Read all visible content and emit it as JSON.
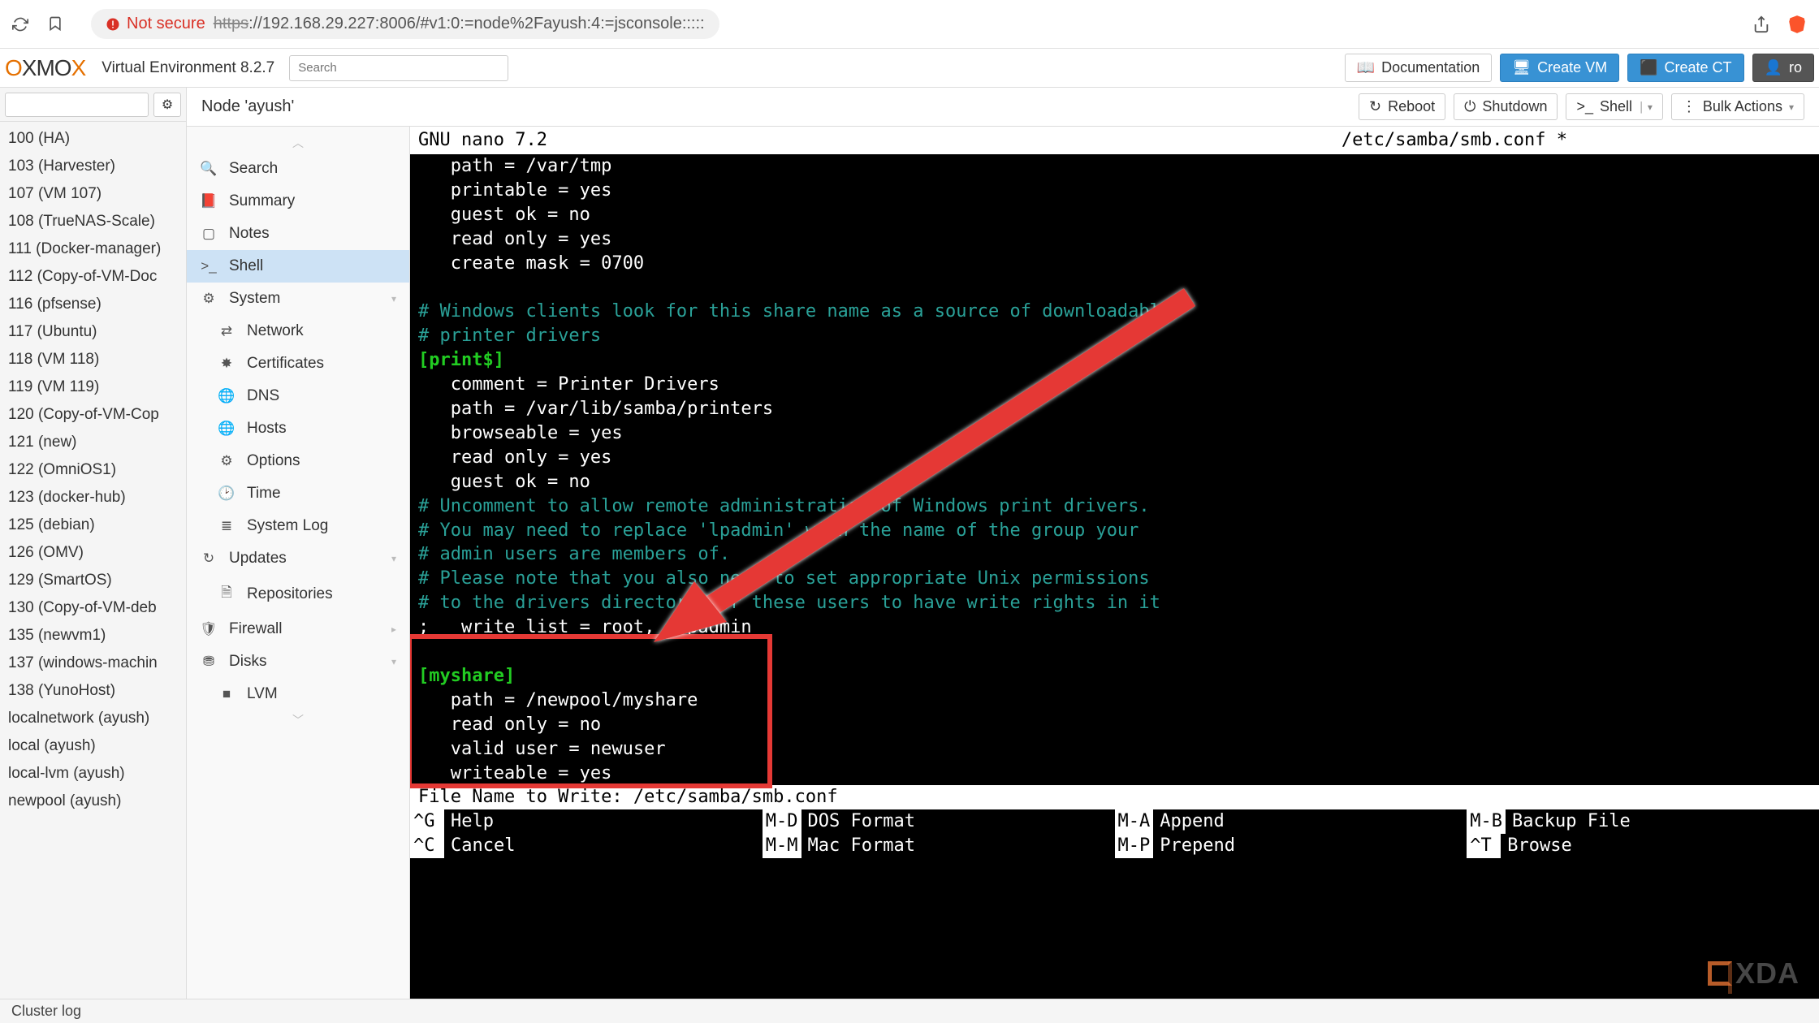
{
  "browser": {
    "not_secure": "Not secure",
    "url_scheme": "https",
    "url_rest": "://192.168.29.227:8006/#v1:0:=node%2Fayush:4:=jsconsole:::::"
  },
  "header": {
    "logo_pre": "O",
    "logo_mid": "XMO",
    "logo_post": "X",
    "env": "Virtual Environment 8.2.7",
    "search_ph": "Search",
    "doc": "Documentation",
    "create_vm": "Create VM",
    "create_ct": "Create CT",
    "root": "ro"
  },
  "tree": [
    "100 (HA)",
    "103 (Harvester)",
    "107 (VM 107)",
    "108 (TrueNAS-Scale)",
    "111 (Docker-manager)",
    "112 (Copy-of-VM-Doc",
    "116 (pfsense)",
    "117 (Ubuntu)",
    "118 (VM 118)",
    "119 (VM 119)",
    "120 (Copy-of-VM-Cop",
    "121 (new)",
    "122 (OmniOS1)",
    "123 (docker-hub)",
    "125 (debian)",
    "126 (OMV)",
    "129 (SmartOS)",
    "130 (Copy-of-VM-deb",
    "135 (newvm1)",
    "137 (windows-machin",
    "138 (YunoHost)",
    "localnetwork (ayush)",
    "local (ayush)",
    "local-lvm (ayush)",
    "newpool (ayush)"
  ],
  "content": {
    "title": "Node 'ayush'",
    "reboot": "Reboot",
    "shutdown": "Shutdown",
    "shell": "Shell",
    "bulk": "Bulk Actions"
  },
  "menu": {
    "search": "Search",
    "summary": "Summary",
    "notes": "Notes",
    "shell": "Shell",
    "system": "System",
    "network": "Network",
    "certificates": "Certificates",
    "dns": "DNS",
    "hosts": "Hosts",
    "options": "Options",
    "time": "Time",
    "system_log": "System Log",
    "updates": "Updates",
    "repositories": "Repositories",
    "firewall": "Firewall",
    "disks": "Disks",
    "lvm": "LVM"
  },
  "term": {
    "editor": "  GNU nano 7.2",
    "filename": "/etc/samba/smb.conf *",
    "l1": "   path = /var/tmp",
    "l2": "   printable = yes",
    "l3": "   guest ok = no",
    "l4": "   read only = yes",
    "l5": "   create mask = 0700",
    "c1": "# Windows clients look for this share name as a source of downloadable",
    "c2": "# printer drivers",
    "s1": "[print$]",
    "l6": "   comment = Printer Drivers",
    "l7": "   path = /var/lib/samba/printers",
    "l8": "   browseable = yes",
    "l9": "   read only = yes",
    "l10": "   guest ok = no",
    "c3": "# Uncomment to allow remote administration of Windows print drivers.",
    "c4": "# You may need to replace 'lpadmin' with the name of the group your",
    "c5": "# admin users are members of.",
    "c6": "# Please note that you also need to set appropriate Unix permissions",
    "c7": "# to the drivers directory for these users to have write rights in it",
    "l11": ";   write list = root, @lpadmin",
    "s2": "[myshare]",
    "l12": "   path = /newpool/myshare",
    "l13": "   read only = no",
    "l14": "   valid user = newuser",
    "l15": "   writeable = yes",
    "prompt": "File Name to Write: /etc/samba/smb.conf",
    "foot": [
      {
        "k": "^G",
        "l": "Help"
      },
      {
        "k": "^C",
        "l": "Cancel"
      },
      {
        "k": "M-D",
        "l": "DOS Format"
      },
      {
        "k": "M-M",
        "l": "Mac Format"
      },
      {
        "k": "M-A",
        "l": "Append"
      },
      {
        "k": "M-P",
        "l": "Prepend"
      },
      {
        "k": "M-B",
        "l": "Backup File"
      },
      {
        "k": "^T",
        "l": "Browse"
      }
    ]
  },
  "status": "Cluster log",
  "watermark": "XDA"
}
